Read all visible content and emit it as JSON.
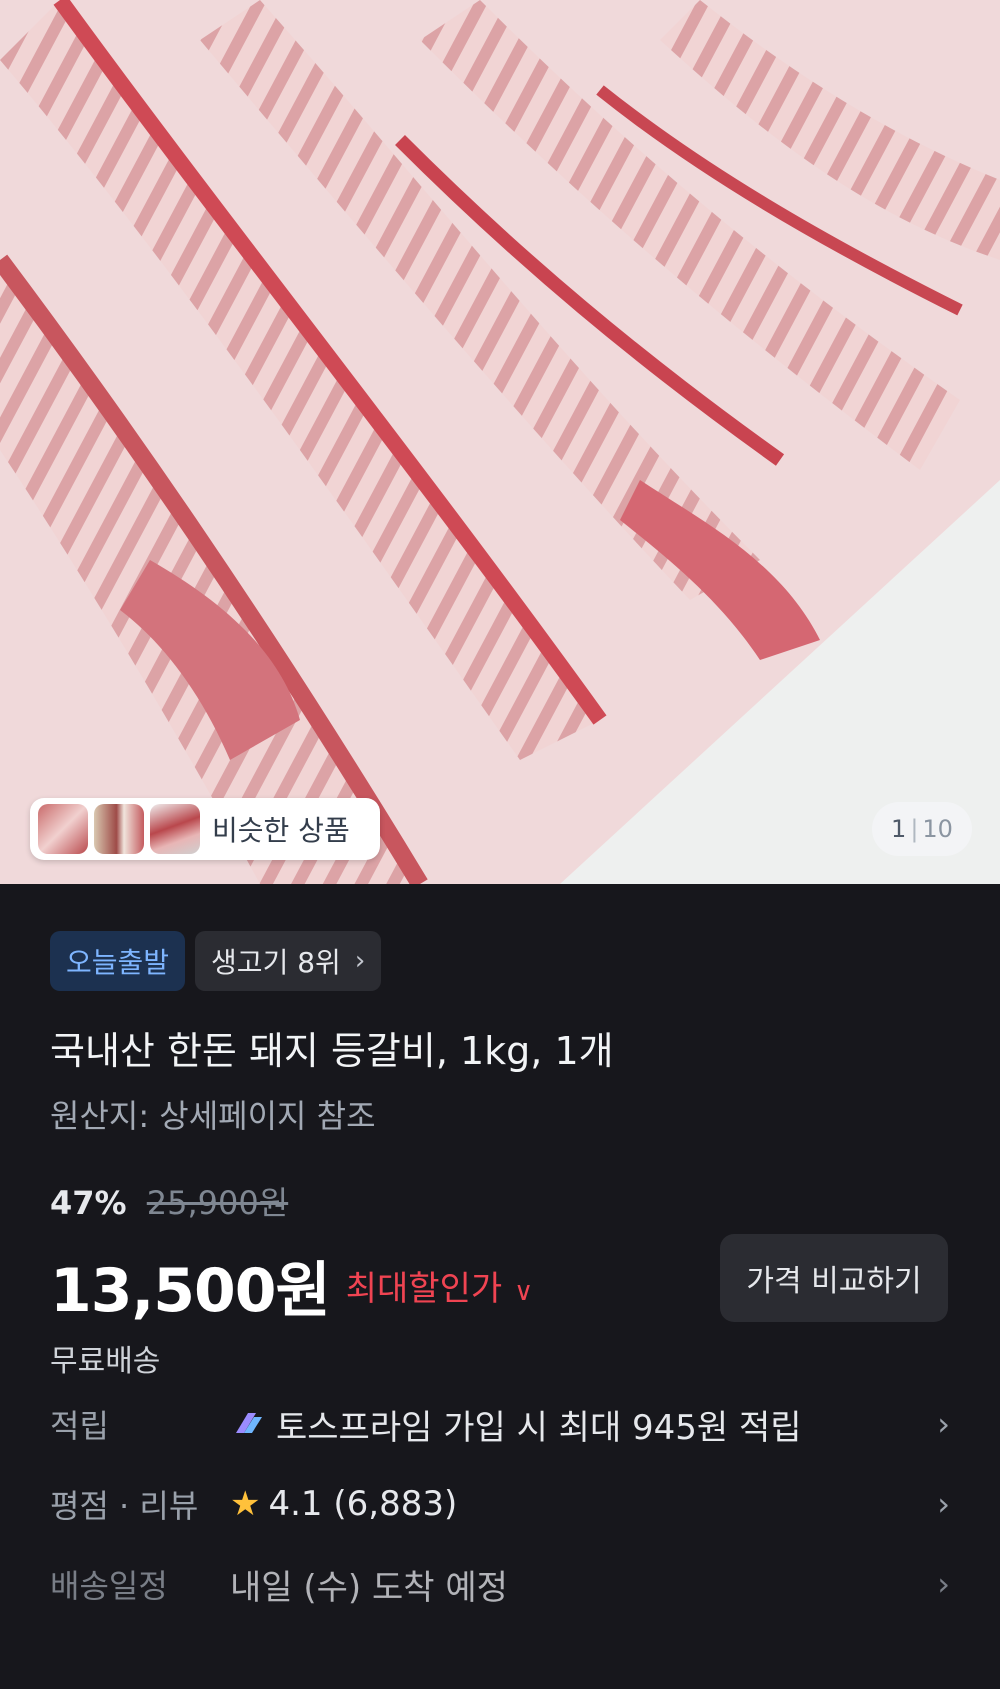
{
  "gallery": {
    "similar_label": "비슷한 상품",
    "page_current": "1",
    "page_separator": "|",
    "page_total": "10"
  },
  "badges": {
    "today_ship": "오늘출발",
    "rank": "생고기 8위"
  },
  "product": {
    "title": "국내산 한돈 돼지 등갈비, 1kg, 1개",
    "origin": "원산지: 상세페이지 참조"
  },
  "pricing": {
    "discount_rate": "47%",
    "original_price": "25,900원",
    "price": "13,500원",
    "max_discount_label": "최대할인가",
    "compare_button": "가격 비교하기",
    "shipping": "무료배송"
  },
  "details": {
    "points_label": "적립",
    "points_value": "토스프라임 가입 시 최대 945원 적립",
    "rating_label": "평점 · 리뷰",
    "rating_value": "4.1 (6,883)",
    "delivery_label": "배송일정",
    "delivery_value": "내일 (수) 도착 예정"
  },
  "colors": {
    "background": "#17171c",
    "accent_red": "#f04452",
    "badge_blue": "#7eb5ff",
    "star": "#ffc13b"
  }
}
